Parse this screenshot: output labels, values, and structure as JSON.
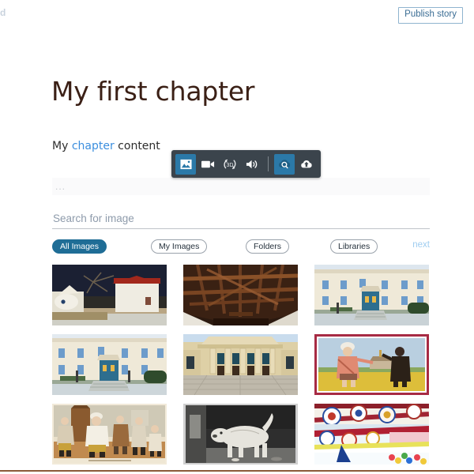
{
  "topbar": {
    "corner_fragment": "d",
    "publish_label": "Publish story"
  },
  "editor": {
    "chapter_title": "My first chapter",
    "body_prefix": "My ",
    "body_link": "chapter",
    "body_suffix": " content"
  },
  "media_toolbar": {
    "icons": [
      {
        "name": "image-icon",
        "label": "Image",
        "active": true
      },
      {
        "name": "video-icon",
        "label": "Video",
        "active": false
      },
      {
        "name": "three-d-icon",
        "label": "3D",
        "active": false
      },
      {
        "name": "audio-icon",
        "label": "Audio",
        "active": false
      },
      {
        "name": "cloud-search-icon",
        "label": "Search cloud",
        "active": true
      },
      {
        "name": "cloud-upload-icon",
        "label": "Upload",
        "active": false
      }
    ]
  },
  "picker": {
    "dots_label": "...",
    "search": {
      "placeholder": "Search for image",
      "value": ""
    },
    "filters": [
      {
        "label": "All Images",
        "active": true
      },
      {
        "label": "My Images",
        "active": false
      },
      {
        "label": "Folders",
        "active": false
      },
      {
        "label": "Libraries",
        "active": false
      }
    ],
    "next_label": "next",
    "results": [
      {
        "alt": "Whitewashed windmill with red roof by the sea"
      },
      {
        "alt": "Wooden beamed ceiling interior"
      },
      {
        "alt": "Neoclassical building with blue shuttered windows"
      },
      {
        "alt": "Neoclassical mansion with staircase and blue door"
      },
      {
        "alt": "Columned civic building facade"
      },
      {
        "alt": "Framed folk painting of two figures on yellow ground"
      },
      {
        "alt": "Colour engraving of men in a tavern"
      },
      {
        "alt": "Black and white engraving of a dog"
      },
      {
        "alt": "Colourful painted plates and textiles"
      }
    ]
  },
  "colors": {
    "accent_blue": "#1f6d96",
    "link_blue": "#3b8ede",
    "toolbar_dark": "#3b444c",
    "title_brown": "#3b2016",
    "rule_brown": "#8a5a3a"
  }
}
